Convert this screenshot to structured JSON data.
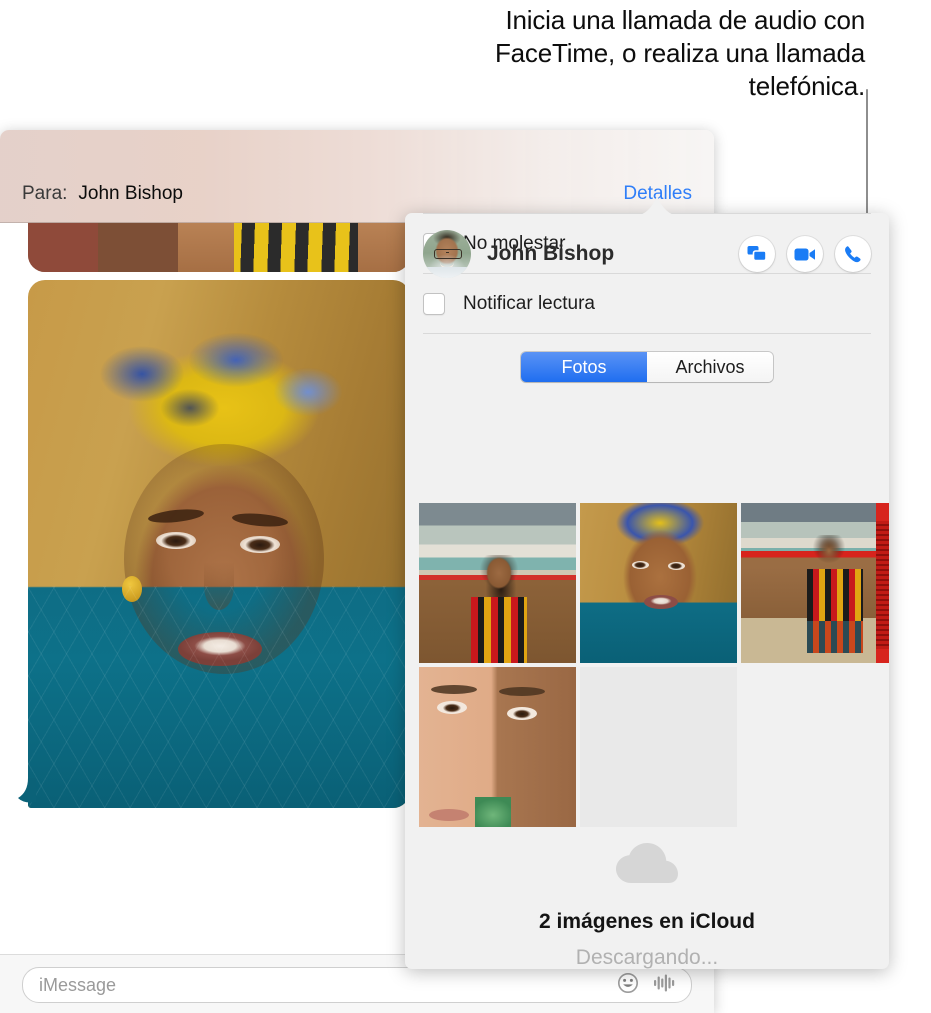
{
  "callout": {
    "text": "Inicia una llamada de audio con FaceTime, o realiza una llamada telefónica."
  },
  "conversation": {
    "to_label": "Para:",
    "recipient": "John Bishop",
    "details_link": "Detalles",
    "input": {
      "placeholder": "iMessage",
      "value": "",
      "emoji_icon": "smiley-icon",
      "audio_icon": "audio-waveform-icon"
    }
  },
  "details_popover": {
    "contact_name": "John Bishop",
    "avatar_icon": "contact-avatar",
    "actions": [
      {
        "name": "screen-share-button",
        "icon": "screen-share-icon"
      },
      {
        "name": "facetime-video-button",
        "icon": "video-camera-icon"
      },
      {
        "name": "audio-call-button",
        "icon": "phone-handset-icon"
      }
    ],
    "options": [
      {
        "label": "No molestar",
        "checked": false
      },
      {
        "label": "Notificar lectura",
        "checked": false
      }
    ],
    "tabs": [
      {
        "label": "Fotos",
        "selected": true
      },
      {
        "label": "Archivos",
        "selected": false
      }
    ],
    "attachments": [
      {
        "name": "photo-thumbnail-1"
      },
      {
        "name": "photo-thumbnail-2"
      },
      {
        "name": "photo-thumbnail-3"
      },
      {
        "name": "photo-thumbnail-4"
      },
      {
        "name": "photo-placeholder"
      }
    ],
    "footer": {
      "cloud_icon": "icloud-icon",
      "count_label": "2 imágenes en iCloud",
      "status_label": "Descargando..."
    }
  },
  "colors": {
    "accent_blue": "#2f7ef8",
    "segment_selected": "#1f6ef0",
    "popover_bg": "#f1f1f1",
    "status_gray": "#b1b1b1"
  }
}
